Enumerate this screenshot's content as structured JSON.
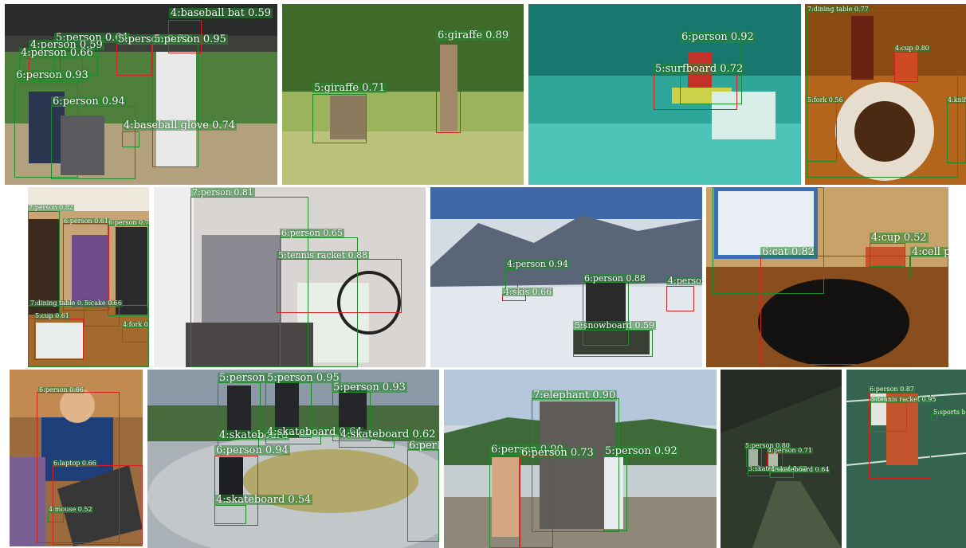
{
  "tiles": [
    {
      "id": "baseball",
      "labels": [
        "4:baseball bat 0.59",
        "5:person 0.64",
        "5:person 0.72",
        "5:person 0.95",
        "4:person 0.59",
        "4:person 0.66",
        "6:person 0.93",
        "6:person 0.94",
        "4:baseball glove 0.74"
      ]
    },
    {
      "id": "giraffes",
      "labels": [
        "6:giraffe 0.89",
        "5:giraffe 0.71"
      ]
    },
    {
      "id": "surfer",
      "labels": [
        "6:person 0.92",
        "5:surfboard 0.72"
      ]
    },
    {
      "id": "dinner",
      "labels": [
        "7:dining table 0.77",
        "4:cup 0.80",
        "5:fork 0.56",
        "4:knife"
      ]
    },
    {
      "id": "kitchen",
      "labels": [
        "7:person 0.82",
        "6:person 0.61",
        "6:person 0.74",
        "7:dining table 0.78",
        "5:cake 0.66",
        "5:cup 0.61",
        "4:fork 0.6"
      ]
    },
    {
      "id": "tennis-wheelchair",
      "labels": [
        "7:person 0.81",
        "6:person 0.65",
        "5:tennis racket 0.88"
      ]
    },
    {
      "id": "snow",
      "labels": [
        "4:person 0.94",
        "4:skis 0.66",
        "6:person 0.88",
        "4:person",
        "5:snowboard 0.59"
      ]
    },
    {
      "id": "cat-laptop",
      "labels": [
        "6:cat 0.82",
        "4:cup 0.52",
        "4:cell ph"
      ]
    },
    {
      "id": "girl-laptop",
      "labels": [
        "6:person 0.66",
        "6:laptop 0.66",
        "4:mouse 0.52"
      ]
    },
    {
      "id": "skatepark",
      "labels": [
        "5:person",
        "5:person 0.95",
        "5:person 0.93",
        "4:skateboard",
        "4:skateboard 0.64",
        "4:skateboard 0.62",
        "6:person 0.94",
        "6:per",
        "4:skateboard 0.54"
      ]
    },
    {
      "id": "elephant",
      "labels": [
        "7:elephant 0.90",
        "6:person 0.90",
        "6:person 0.73",
        "5:person 0.92"
      ]
    },
    {
      "id": "night-skate",
      "labels": [
        "5:person 0.80",
        "4:person 0.71",
        "3:skateboard 0.63",
        "4:skateboard 0.64"
      ]
    },
    {
      "id": "tennis-court",
      "labels": [
        "6:person 0.87",
        "5:tennis racket 0.95",
        "5:sports ba"
      ]
    }
  ]
}
